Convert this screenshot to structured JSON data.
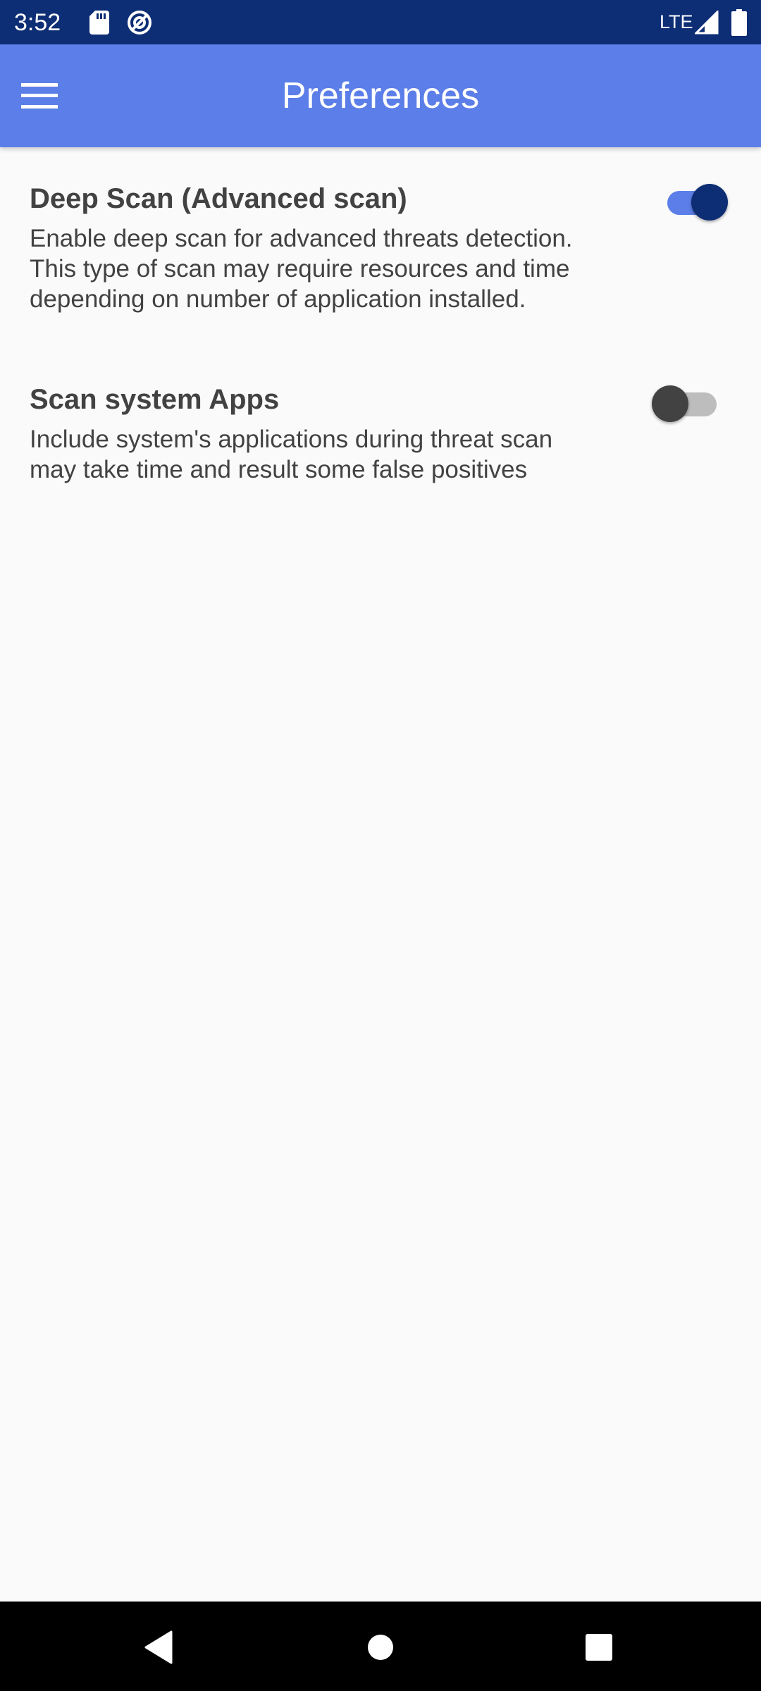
{
  "status_bar": {
    "time": "3:52",
    "network": "LTE",
    "icons": [
      "sd-card-icon",
      "data-saver-icon",
      "signal-icon",
      "battery-icon"
    ]
  },
  "app_bar": {
    "title": "Preferences",
    "menu_icon": "hamburger-menu-icon"
  },
  "preferences": [
    {
      "title": "Deep Scan (Advanced scan)",
      "summary": "Enable deep scan for advanced threats detection.\nThis type of scan may require resources and time\ndepending on number of application installed.",
      "enabled": true
    },
    {
      "title": "Scan system Apps",
      "summary": "Include system's applications during threat scan\nmay take time and result some false positives",
      "enabled": false
    }
  ],
  "nav_bar": {
    "icons": [
      "back-icon",
      "home-icon",
      "recents-icon"
    ]
  },
  "colors": {
    "status_bar": "#0d2e75",
    "app_bar": "#5b7ee8",
    "switch_on_thumb": "#0d2e75",
    "switch_on_track": "#5b7ee8",
    "background": "#fafafa",
    "text": "#424242"
  }
}
